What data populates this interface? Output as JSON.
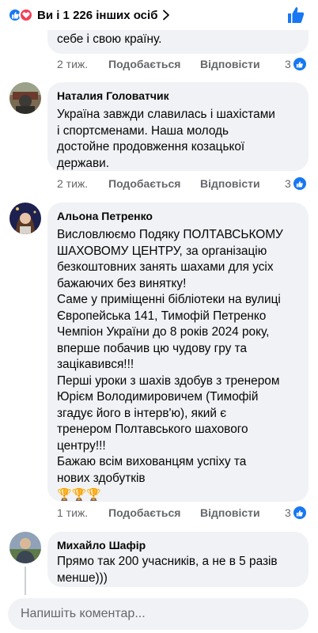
{
  "header": {
    "reactions_summary": "Ви і 1 226 інших осіб",
    "icons": [
      "like-icon",
      "love-icon",
      "chevron-right-icon",
      "thumbs-up-icon"
    ]
  },
  "colors": {
    "accent": "#1877f2",
    "love": "#f33e58",
    "bubble": "#f0f2f5",
    "meta": "#65676b"
  },
  "actions": {
    "like": "Подобається",
    "reply": "Відповісти"
  },
  "comments": [
    {
      "text": "себе і свою країну.",
      "time": "2 тиж.",
      "reaction_count": "3"
    },
    {
      "author": "Наталия Головатчик",
      "text": "Україна завжди славилась і шахістами\nі спортсменами. Наша молодь\nдостойне продовження козацької\nдержави.",
      "time": "2 тиж.",
      "reaction_count": "3"
    },
    {
      "author": "Альона Петренко",
      "text": "Висловлюємо Подяку ПОЛТАВСЬКОМУ\nШАХОВОМУ ЦЕНТРУ, за організацію\nбезкоштовних занять шахами для усіх\nбажаючих без винятку!\nСаме у приміщенні бібліотеки на вулиці\nЄвропейська 141, Тимофій Петренко\nЧемпіон України до 8 років 2024 року,\nвперше побачив цю чудову гру та\nзацікавився!!!\nПерші уроки з шахів здобув з тренером\nЮрієм Володимировичем (Тимофій\nзгадує його в інтерв'ю), який є\nтренером Полтавського шахового\nцентру!!!\nБажаю всім вихованцям успіху та\nнових здобутків",
      "emoji": "🏆🏆🏆",
      "time": "1 тиж.",
      "reaction_count": "3"
    },
    {
      "author": "Михайло Шафір",
      "text": "Прямо так 200 учасників,  а не в 5 разів\nменше)))"
    }
  ],
  "composer": {
    "placeholder": "Напишіть коментар..."
  }
}
